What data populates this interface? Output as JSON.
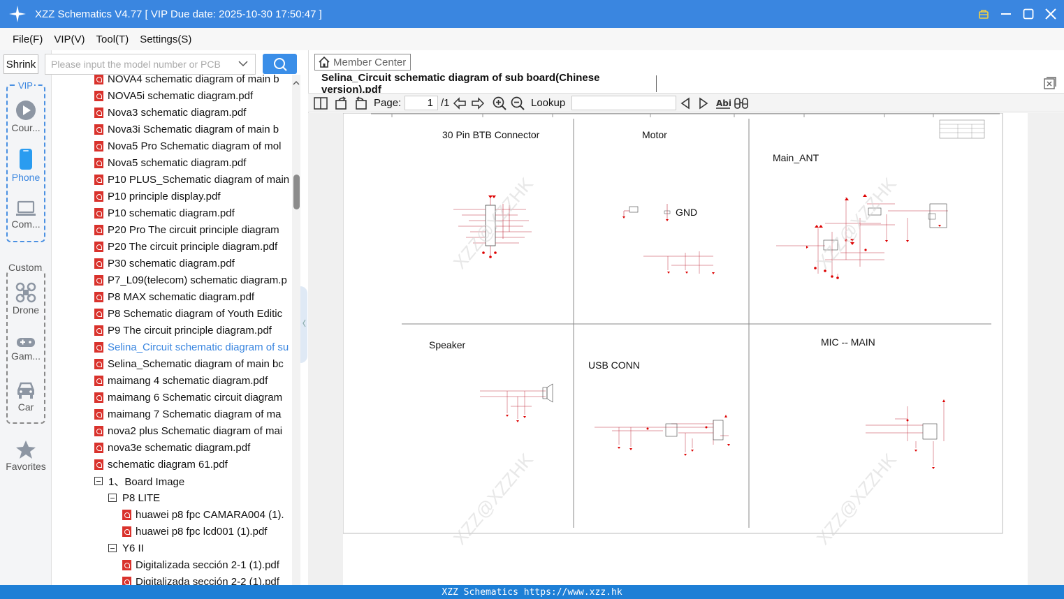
{
  "window": {
    "title": "XZZ Schematics V4.77 [ VIP Due date: 2025-10-30 17:50:47 ]"
  },
  "menu": [
    "File(F)",
    "VIP(V)",
    "Tool(T)",
    "Settings(S)"
  ],
  "search": {
    "shrink_label": "Shrink",
    "placeholder": "Please input the model number or PCB"
  },
  "rail": {
    "vip_label": "VIP",
    "custom_label": "Custom",
    "items": [
      {
        "label": "Cour...",
        "icon": "play-icon"
      },
      {
        "label": "Phone",
        "icon": "phone-icon"
      },
      {
        "label": "Com...",
        "icon": "laptop-icon"
      },
      {
        "label": "Drone",
        "icon": "drone-icon"
      },
      {
        "label": "Gam...",
        "icon": "gamepad-icon"
      },
      {
        "label": "Car",
        "icon": "car-icon"
      },
      {
        "label": "Favorites",
        "icon": "star-icon"
      }
    ]
  },
  "tree": [
    {
      "label": "NOVA4 schematic diagram of main b",
      "type": "pdf"
    },
    {
      "label": "NOVA5i schematic diagram.pdf",
      "type": "pdf"
    },
    {
      "label": "Nova3 schematic diagram.pdf",
      "type": "pdf"
    },
    {
      "label": "Nova3i Schematic diagram of main b",
      "type": "pdf"
    },
    {
      "label": "Nova5 Pro Schematic diagram of mol",
      "type": "pdf"
    },
    {
      "label": "Nova5 schematic diagram.pdf",
      "type": "pdf"
    },
    {
      "label": "P10 PLUS_Schematic diagram of main",
      "type": "pdf"
    },
    {
      "label": "P10 principle display.pdf",
      "type": "pdf"
    },
    {
      "label": "P10 schematic diagram.pdf",
      "type": "pdf"
    },
    {
      "label": "P20 Pro The circuit principle diagram",
      "type": "pdf"
    },
    {
      "label": "P20 The circuit principle diagram.pdf",
      "type": "pdf"
    },
    {
      "label": "P30 schematic diagram.pdf",
      "type": "pdf"
    },
    {
      "label": "P7_L09(telecom) schematic diagram.p",
      "type": "pdf"
    },
    {
      "label": "P8 MAX schematic diagram.pdf",
      "type": "pdf"
    },
    {
      "label": "P8 Schematic diagram of Youth Editic",
      "type": "pdf"
    },
    {
      "label": "P9 The circuit principle diagram.pdf",
      "type": "pdf"
    },
    {
      "label": "Selina_Circuit schematic diagram of su",
      "type": "pdf",
      "selected": true
    },
    {
      "label": "Selina_Schematic diagram of main bc",
      "type": "pdf"
    },
    {
      "label": "maimang 4 schematic diagram.pdf",
      "type": "pdf"
    },
    {
      "label": "maimang 6 Schematic circuit diagram",
      "type": "pdf"
    },
    {
      "label": "maimang 7 Schematic diagram of ma",
      "type": "pdf"
    },
    {
      "label": "nova2 plus Schematic diagram of mai",
      "type": "pdf"
    },
    {
      "label": "nova3e schematic diagram.pdf",
      "type": "pdf"
    },
    {
      "label": "schematic diagram 61.pdf",
      "type": "pdf"
    },
    {
      "label": "1、Board Image",
      "type": "folder",
      "level": 0
    },
    {
      "label": "P8 LITE",
      "type": "folder",
      "level": 1
    },
    {
      "label": "huawei p8 fpc CAMARA004 (1).",
      "type": "pdf",
      "level": 2
    },
    {
      "label": "huawei p8 fpc lcd001 (1).pdf",
      "type": "pdf",
      "level": 2
    },
    {
      "label": "Y6 II",
      "type": "folder",
      "level": 1
    },
    {
      "label": "Digitalizada sección 2-1 (1).pdf",
      "type": "pdf",
      "level": 2
    },
    {
      "label": "Digitalizada sección 2-2 (1).pdf",
      "type": "pdf",
      "level": 2
    }
  ],
  "viewer": {
    "member_center": "Member Center",
    "tab_title": "Selina_Circuit schematic diagram of sub board(Chinese version).pdf",
    "page_label": "Page:",
    "page_current": "1",
    "page_total": "/1",
    "lookup_label": "Lookup"
  },
  "schematic": {
    "sections": [
      "30 Pin BTB Connector",
      "Motor",
      "Main_ANT",
      "Speaker",
      "USB CONN",
      "MIC -- MAIN"
    ],
    "gnd_label": "GND",
    "watermark": "XZZ@XZZHK"
  },
  "status": "XZZ Schematics https://www.xzz.hk",
  "colors": {
    "accent": "#3a86e0",
    "pdf_red": "#d9322c"
  }
}
